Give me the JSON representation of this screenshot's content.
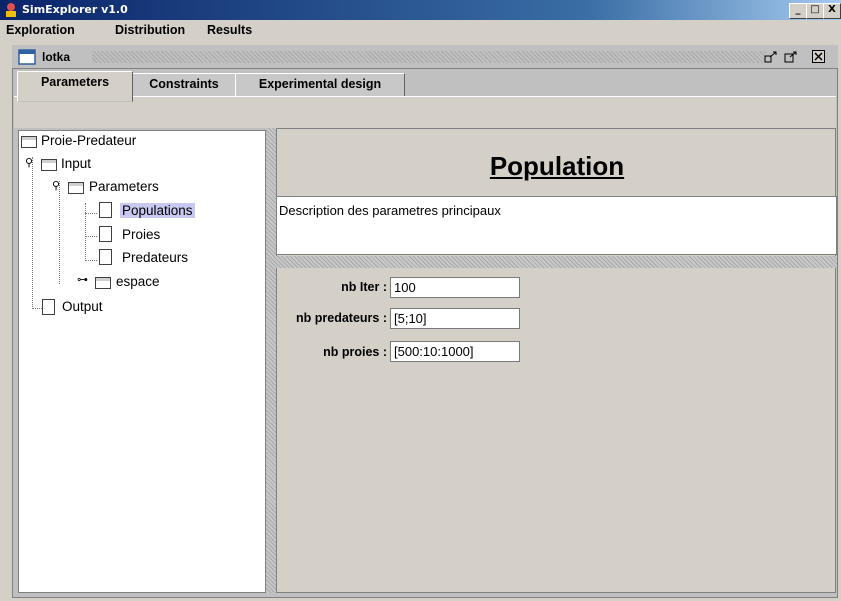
{
  "window": {
    "title": "SimExplorer v1.0",
    "min": "_",
    "max": "□",
    "close": "X"
  },
  "menu": {
    "items": [
      "Exploration",
      "Distribution",
      "Results"
    ]
  },
  "frame": {
    "title": "lotka"
  },
  "tabs": [
    "Parameters",
    "Constraints",
    "Experimental design"
  ],
  "tree": {
    "root": "Proie-Predateur",
    "input": "Input",
    "parameters": "Parameters",
    "populations": "Populations",
    "proies": "Proies",
    "predateurs": "Predateurs",
    "espace": "espace",
    "output": "Output"
  },
  "content": {
    "title": "Population",
    "description": "Description des parametres principaux",
    "fields": [
      {
        "label": "nb Iter :",
        "value": "100"
      },
      {
        "label": "nb predateurs :",
        "value": "[5;10]"
      },
      {
        "label": "nb proies :",
        "value": "[500:10:1000]"
      }
    ]
  },
  "colors": {
    "titlebar": "#0a246a",
    "selection": "#c8c8f0",
    "panel": "#d4d0c8"
  }
}
